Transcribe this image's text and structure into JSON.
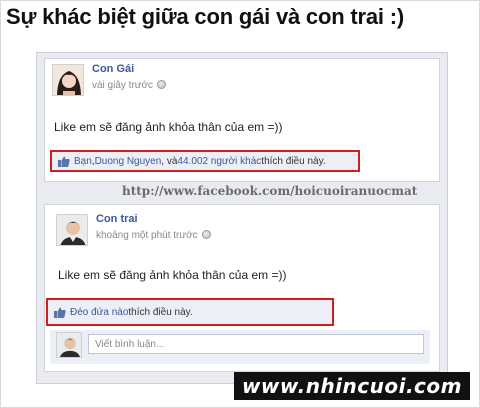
{
  "headline": "Sự khác biệt giữa con gái và con trai :)",
  "watermark_url": "http://www.facebook.com/hoicuoiranuocmat",
  "site_logo": "www.nhincuoi.com",
  "posts": [
    {
      "author": "Con Gái",
      "time": "vài giây trước",
      "message": "Like em sẽ đăng ảnh khỏa thân của em =))",
      "likes": {
        "name1": "Bạn",
        "sep": ", ",
        "name2": "Duong Nguyen",
        "mid": ", và ",
        "others": "44.002 người khác",
        "suffix": " thích điều này."
      }
    },
    {
      "author": "Con trai",
      "time": "khoảng một phút trước",
      "message": "Like em sẽ đăng ảnh khỏa thân của em =))",
      "likes": {
        "link": "Đéo đứa nào",
        "suffix": " thích điều này."
      },
      "comment_placeholder": "Viết bình luận..."
    }
  ],
  "colors": {
    "link": "#3b5998",
    "highlight_border": "#d11f1f",
    "likebar_bg": "#eceff5"
  },
  "icons": [
    "globe-icon",
    "thumbs-up-icon"
  ]
}
